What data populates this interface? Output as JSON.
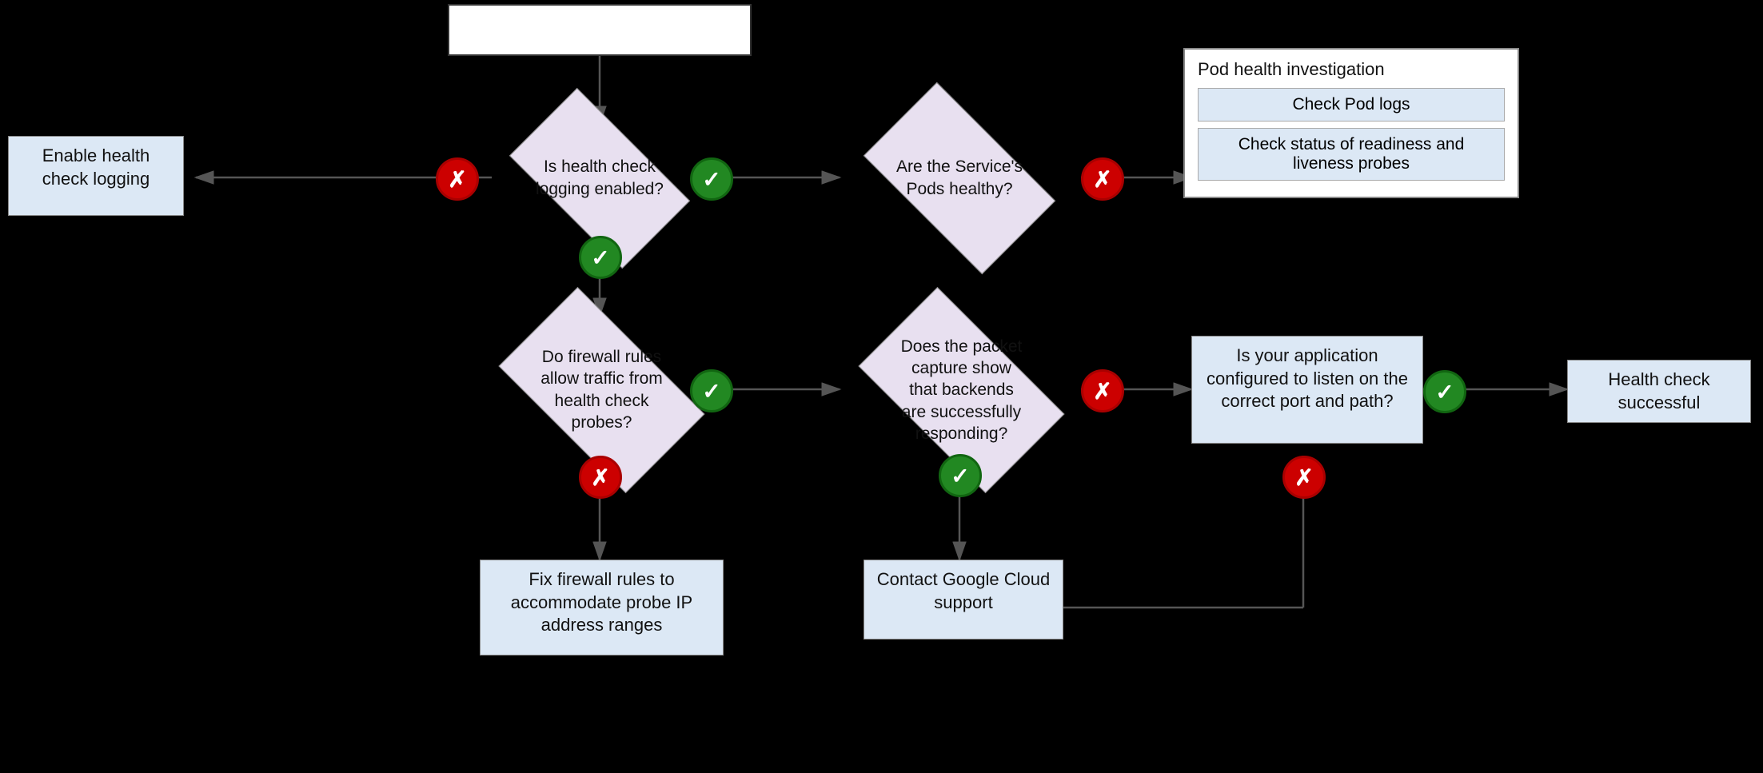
{
  "start": {
    "label": ""
  },
  "nodes": {
    "enable_logging": "Enable health check logging",
    "is_logging_enabled": "Is health check logging enabled?",
    "are_pods_healthy": "Are the Service's Pods healthy?",
    "do_firewall_allow": "Do firewall rules allow traffic from health check probes?",
    "packet_capture": "Does the packet capture show that backends are successfully responding?",
    "fix_firewall": "Fix firewall rules to accommodate probe IP address ranges",
    "contact_support": "Contact Google Cloud support",
    "correct_port": "Is your application configured to listen on the correct port and path?",
    "health_check_successful": "Health check successful",
    "pod_investigation_title": "Pod health investigation",
    "check_pod_logs": "Check Pod logs",
    "check_readiness": "Check status of readiness and liveness probes"
  },
  "connectors": {
    "no": "✗",
    "yes": "✓"
  },
  "colors": {
    "red": "#cc0000",
    "green": "#228822",
    "box_bg": "#dce8f5",
    "diamond_bg": "#e8e0f0",
    "white": "#ffffff",
    "border": "#888888"
  }
}
